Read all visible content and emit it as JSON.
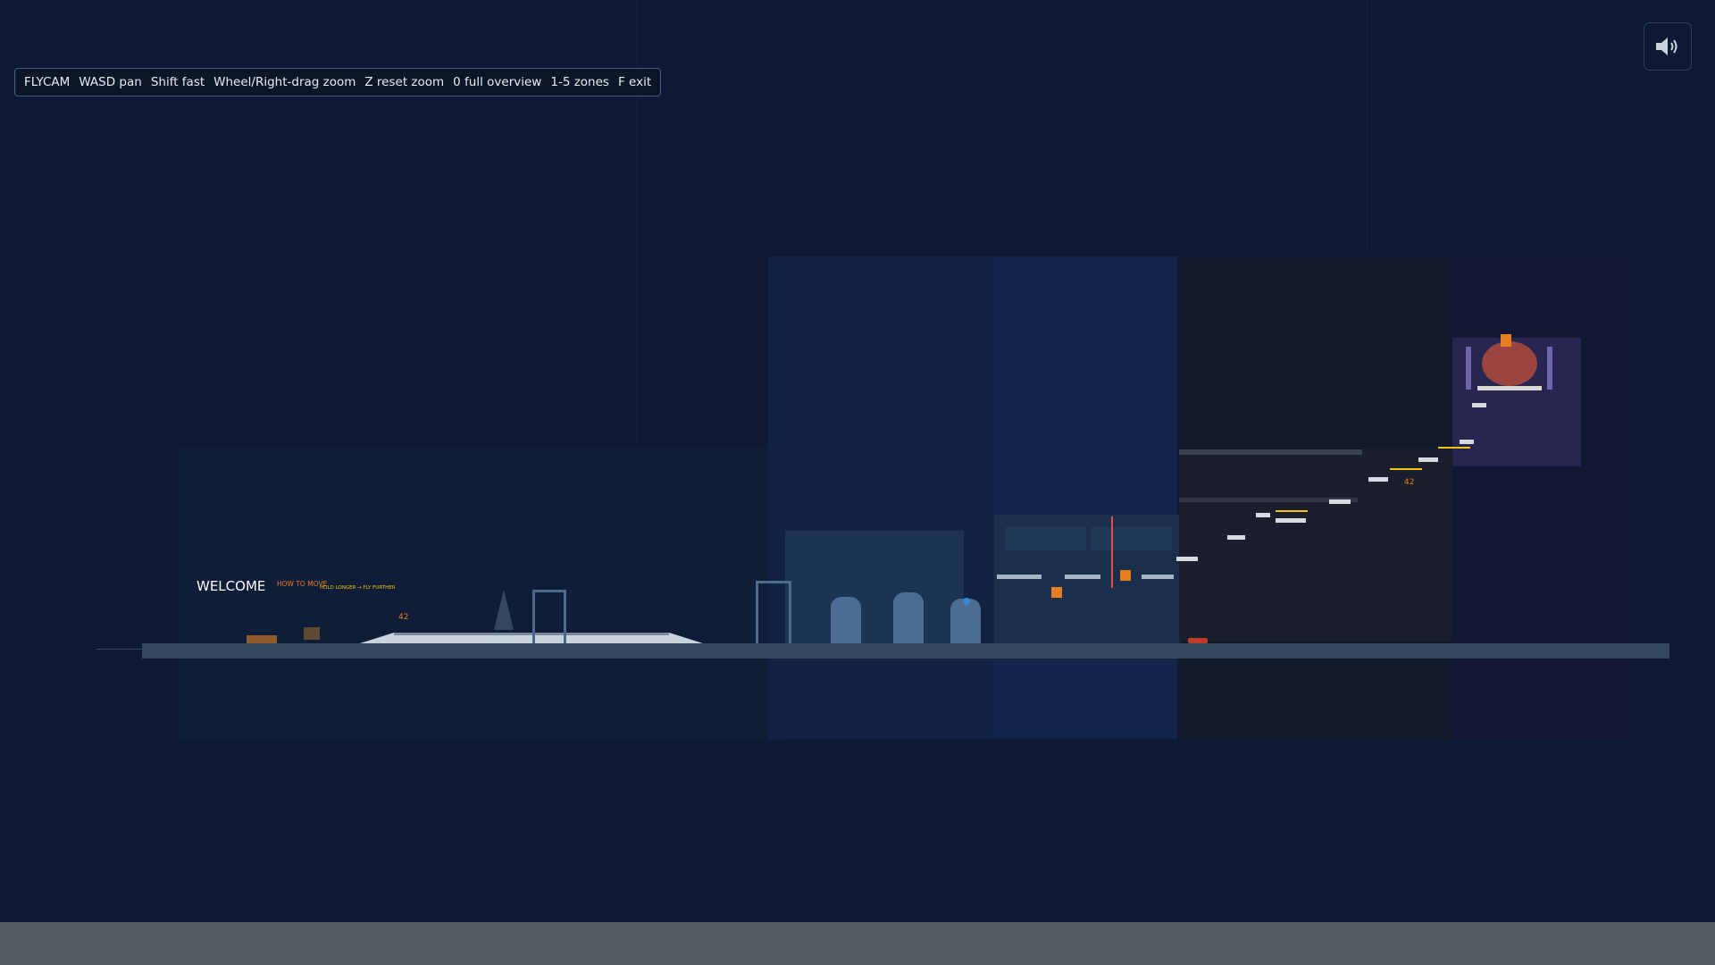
{
  "hud": {
    "items": [
      "FLYCAM",
      "WASD pan",
      "Shift fast",
      "Wheel/Right-drag zoom",
      "Z reset zoom",
      "0 full overview",
      "1-5 zones",
      "F exit"
    ]
  },
  "sound_button": {
    "icon": "speaker-volume-icon"
  },
  "world": {
    "welcome_title": "WELCOME",
    "how_to_move": "HOW TO MOVE",
    "hold_longer": "HOLD LONGER → FLY FURTHER",
    "score_a": "42",
    "score_b": "42"
  },
  "colors": {
    "background": "#0e1a33",
    "ground": "#34495e",
    "accent_orange": "#e67e22",
    "accent_yellow": "#f1c40f",
    "zone_blue": "#1d3354",
    "zone_dark": "#151d2c",
    "zone_purple": "#2a2550"
  }
}
